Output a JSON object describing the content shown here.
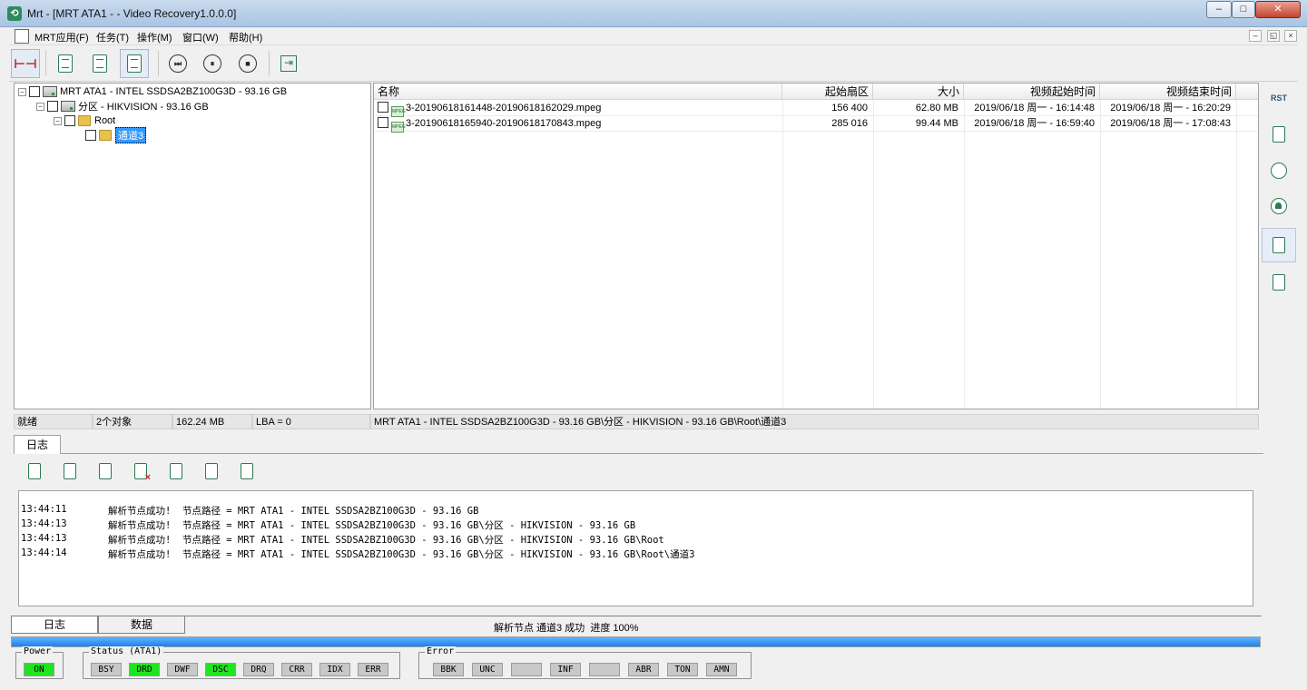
{
  "window": {
    "title": "Mrt - [MRT ATA1 -  - Video Recovery1.0.0.0]",
    "controls": {
      "minimize": "‒",
      "maximize": "□",
      "close": "✕"
    }
  },
  "menu": {
    "items": [
      "MRT应用(F)",
      "任务(T)",
      "操作(M)",
      "窗口(W)",
      "帮助(H)"
    ],
    "mdi": [
      "–",
      "◱",
      "×"
    ]
  },
  "toolbar": {
    "buttons": [
      {
        "name": "connect-icon",
        "glyph": "⊢⊣"
      },
      {
        "name": "report-icon"
      },
      {
        "name": "view-icon"
      },
      {
        "name": "list-icon"
      },
      {
        "name": "skip-icon",
        "glyph": "⏭"
      },
      {
        "name": "pause-icon",
        "glyph": "⏸"
      },
      {
        "name": "stop-icon",
        "glyph": "■"
      },
      {
        "name": "exit-icon",
        "glyph": "⇥"
      }
    ]
  },
  "tree": {
    "disk": "MRT ATA1 - INTEL SSDSA2BZ100G3D - 93.16 GB",
    "partition": "分区 - HIKVISION - 93.16 GB",
    "root": "Root",
    "channel": "通道3"
  },
  "list": {
    "columns": [
      "名称",
      "起始扇区",
      "大小",
      "视频起始时间",
      "视频结束时间"
    ],
    "rows": [
      {
        "name": "3-20190618161448-20190618162029.mpeg",
        "sector": "156 400",
        "size": "62.80 MB",
        "start": "2019/06/18 周一 - 16:14:48",
        "end": "2019/06/18 周一 - 16:20:29"
      },
      {
        "name": "3-20190618165940-20190618170843.mpeg",
        "sector": "285 016",
        "size": "99.44 MB",
        "start": "2019/06/18 周一 - 16:59:40",
        "end": "2019/06/18 周一 - 17:08:43"
      }
    ],
    "file_icon_label": "MPEG"
  },
  "sidebar": {
    "rst_label": "RST"
  },
  "statusbar": {
    "state": "就绪",
    "objects": "2个对象",
    "size": "162.24 MB",
    "lba": "LBA = 0",
    "path": "MRT ATA1 - INTEL SSDSA2BZ100G3D - 93.16 GB\\分区 - HIKVISION - 93.16 GB\\Root\\通道3"
  },
  "log": {
    "tab": "日志",
    "lines": [
      {
        "time": "13:44:11",
        "msg": "解析节点成功!  节点路径 = MRT ATA1 - INTEL SSDSA2BZ100G3D - 93.16 GB"
      },
      {
        "time": "13:44:13",
        "msg": "解析节点成功!  节点路径 = MRT ATA1 - INTEL SSDSA2BZ100G3D - 93.16 GB\\分区 - HIKVISION - 93.16 GB"
      },
      {
        "time": "13:44:13",
        "msg": "解析节点成功!  节点路径 = MRT ATA1 - INTEL SSDSA2BZ100G3D - 93.16 GB\\分区 - HIKVISION - 93.16 GB\\Root"
      },
      {
        "time": "13:44:14",
        "msg": "解析节点成功!  节点路径 = MRT ATA1 - INTEL SSDSA2BZ100G3D - 93.16 GB\\分区 - HIKVISION - 93.16 GB\\Root\\通道3"
      }
    ]
  },
  "bottom": {
    "tabs": [
      "日志",
      "数据"
    ],
    "status": "解析节点 通道3 成功  进度 100%",
    "progress": 1.0
  },
  "indicators": {
    "power": {
      "title": "Power",
      "items": [
        {
          "label": "ON",
          "on": true
        }
      ]
    },
    "status": {
      "title": "Status (ATA1)",
      "items": [
        {
          "label": "BSY",
          "on": false
        },
        {
          "label": "DRD",
          "on": true
        },
        {
          "label": "DWF",
          "on": false
        },
        {
          "label": "DSC",
          "on": true
        },
        {
          "label": "DRQ",
          "on": false
        },
        {
          "label": "CRR",
          "on": false
        },
        {
          "label": "IDX",
          "on": false
        },
        {
          "label": "ERR",
          "on": false
        }
      ]
    },
    "error": {
      "title": "Error",
      "items": [
        {
          "label": "BBK",
          "on": false
        },
        {
          "label": "UNC",
          "on": false
        },
        {
          "label": "",
          "on": false
        },
        {
          "label": "INF",
          "on": false
        },
        {
          "label": "",
          "on": false
        },
        {
          "label": "ABR",
          "on": false
        },
        {
          "label": "TON",
          "on": false
        },
        {
          "label": "AMN",
          "on": false
        }
      ]
    }
  },
  "colors": {
    "indicator_on": "#1fe41f",
    "indicator_off": "#c8c8c8",
    "selection": "#3399ff",
    "progress": "#1e82e4"
  }
}
